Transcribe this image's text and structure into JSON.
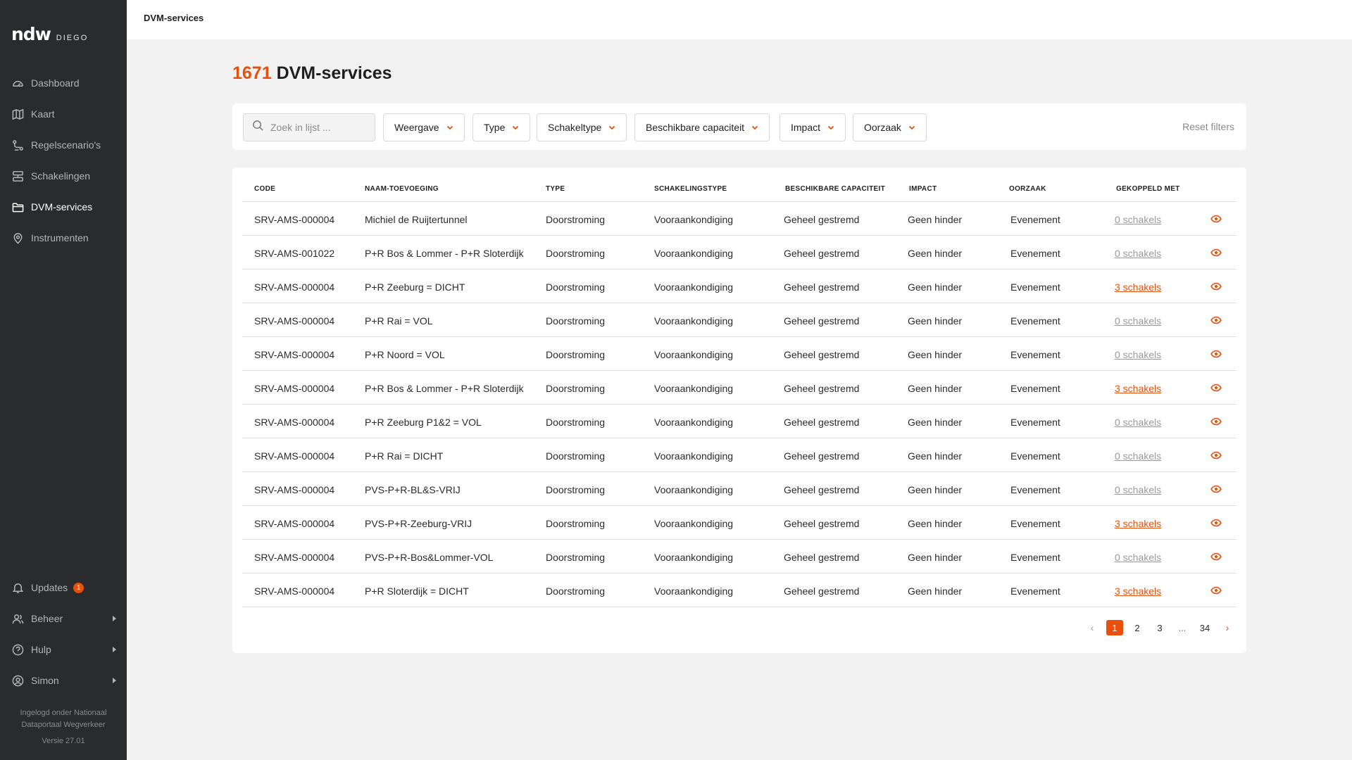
{
  "sidebar": {
    "logo_main": "ndw",
    "logo_sub": "DIEGO",
    "items": [
      {
        "label": "Dashboard",
        "icon": "gauge-icon"
      },
      {
        "label": "Kaart",
        "icon": "map-icon"
      },
      {
        "label": "Regelscenario's",
        "icon": "scenario-icon"
      },
      {
        "label": "Schakelingen",
        "icon": "switch-icon"
      },
      {
        "label": "DVM-services",
        "icon": "folder-icon",
        "active": true
      },
      {
        "label": "Instrumenten",
        "icon": "location-pin-icon"
      }
    ],
    "bottom_items": [
      {
        "label": "Updates",
        "icon": "bell-icon",
        "badge": "1"
      },
      {
        "label": "Beheer",
        "icon": "users-icon"
      },
      {
        "label": "Hulp",
        "icon": "help-icon"
      },
      {
        "label": "Simon",
        "icon": "user-circle-icon"
      }
    ],
    "login_info_line1": "Ingelogd onder Nationaal",
    "login_info_line2": "Dataportaal Wegverkeer",
    "version": "Versie 27.01"
  },
  "topbar": {
    "title": "DVM-services"
  },
  "heading": {
    "count": "1671",
    "title": "DVM-services"
  },
  "filters": {
    "search_placeholder": "Zoek in lijst ...",
    "dropdowns": [
      "Weergave",
      "Type",
      "Schakeltype",
      "Beschikbare capaciteit",
      "Impact",
      "Oorzaak"
    ],
    "reset_label": "Reset filters"
  },
  "table": {
    "columns": [
      "CODE",
      "NAAM-TOEVOEGING",
      "TYPE",
      "SCHAKELINGSTYPE",
      "BESCHIKBARE CAPACITEIT",
      "IMPACT",
      "OORZAAK",
      "GEKOPPELD MET"
    ],
    "rows": [
      {
        "code": "SRV-AMS-000004",
        "naam": "Michiel de Ruijtertunnel",
        "type": "Doorstroming",
        "schakelingstype": "Vooraankondiging",
        "capaciteit": "Geheel gestremd",
        "impact": "Geen hinder",
        "oorzaak": "Evenement",
        "gekoppeld": "0 schakels",
        "linked": false
      },
      {
        "code": "SRV-AMS-001022",
        "naam": "P+R Bos & Lommer - P+R Sloterdijk",
        "type": "Doorstroming",
        "schakelingstype": "Vooraankondiging",
        "capaciteit": "Geheel gestremd",
        "impact": "Geen hinder",
        "oorzaak": "Evenement",
        "gekoppeld": "0 schakels",
        "linked": false
      },
      {
        "code": "SRV-AMS-000004",
        "naam": "P+R Zeeburg = DICHT",
        "type": "Doorstroming",
        "schakelingstype": "Vooraankondiging",
        "capaciteit": "Geheel gestremd",
        "impact": "Geen hinder",
        "oorzaak": "Evenement",
        "gekoppeld": "3 schakels",
        "linked": true
      },
      {
        "code": "SRV-AMS-000004",
        "naam": "P+R Rai = VOL",
        "type": "Doorstroming",
        "schakelingstype": "Vooraankondiging",
        "capaciteit": "Geheel gestremd",
        "impact": "Geen hinder",
        "oorzaak": "Evenement",
        "gekoppeld": "0 schakels",
        "linked": false
      },
      {
        "code": "SRV-AMS-000004",
        "naam": "P+R Noord = VOL",
        "type": "Doorstroming",
        "schakelingstype": "Vooraankondiging",
        "capaciteit": "Geheel gestremd",
        "impact": "Geen hinder",
        "oorzaak": "Evenement",
        "gekoppeld": "0 schakels",
        "linked": false
      },
      {
        "code": "SRV-AMS-000004",
        "naam": "P+R Bos & Lommer - P+R Sloterdijk",
        "type": "Doorstroming",
        "schakelingstype": "Vooraankondiging",
        "capaciteit": "Geheel gestremd",
        "impact": "Geen hinder",
        "oorzaak": "Evenement",
        "gekoppeld": "3 schakels",
        "linked": true
      },
      {
        "code": "SRV-AMS-000004",
        "naam": "P+R Zeeburg P1&2 = VOL",
        "type": "Doorstroming",
        "schakelingstype": "Vooraankondiging",
        "capaciteit": "Geheel gestremd",
        "impact": "Geen hinder",
        "oorzaak": "Evenement",
        "gekoppeld": "0 schakels",
        "linked": false
      },
      {
        "code": "SRV-AMS-000004",
        "naam": "P+R Rai = DICHT",
        "type": "Doorstroming",
        "schakelingstype": "Vooraankondiging",
        "capaciteit": "Geheel gestremd",
        "impact": "Geen hinder",
        "oorzaak": "Evenement",
        "gekoppeld": "0 schakels",
        "linked": false
      },
      {
        "code": "SRV-AMS-000004",
        "naam": "PVS-P+R-BL&S-VRIJ",
        "type": "Doorstroming",
        "schakelingstype": "Vooraankondiging",
        "capaciteit": "Geheel gestremd",
        "impact": "Geen hinder",
        "oorzaak": "Evenement",
        "gekoppeld": "0 schakels",
        "linked": false
      },
      {
        "code": "SRV-AMS-000004",
        "naam": "PVS-P+R-Zeeburg-VRIJ",
        "type": "Doorstroming",
        "schakelingstype": "Vooraankondiging",
        "capaciteit": "Geheel gestremd",
        "impact": "Geen hinder",
        "oorzaak": "Evenement",
        "gekoppeld": "3 schakels",
        "linked": true
      },
      {
        "code": "SRV-AMS-000004",
        "naam": "PVS-P+R-Bos&Lommer-VOL",
        "type": "Doorstroming",
        "schakelingstype": "Vooraankondiging",
        "capaciteit": "Geheel gestremd",
        "impact": "Geen hinder",
        "oorzaak": "Evenement",
        "gekoppeld": "0 schakels",
        "linked": false
      },
      {
        "code": "SRV-AMS-000004",
        "naam": "P+R Sloterdijk = DICHT",
        "type": "Doorstroming",
        "schakelingstype": "Vooraankondiging",
        "capaciteit": "Geheel gestremd",
        "impact": "Geen hinder",
        "oorzaak": "Evenement",
        "gekoppeld": "3 schakels",
        "linked": true
      }
    ]
  },
  "pagination": {
    "prev": "‹",
    "pages": [
      "1",
      "2",
      "3",
      "...",
      "34"
    ],
    "current": "1",
    "next": "›"
  },
  "colors": {
    "accent": "#e8500e",
    "sidebar_bg": "#2a2b2d",
    "page_bg": "#f2f2f2"
  }
}
